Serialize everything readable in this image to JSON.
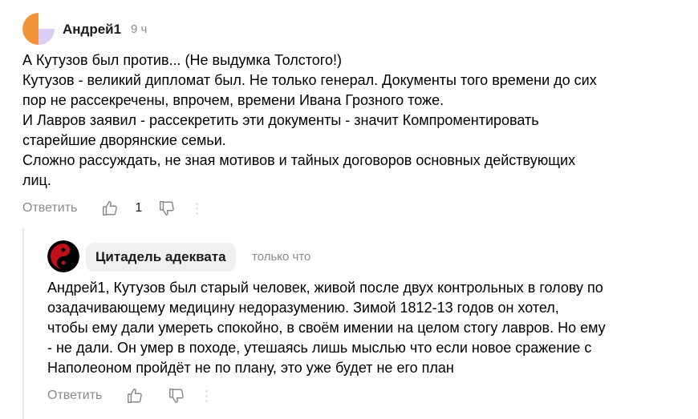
{
  "comments": [
    {
      "author": "Андрей1",
      "time": "9 ч",
      "lines": [
        "А Кутузов был против... (Не выдумка Толстого!)",
        "Кутузов - великий дипломат был. Не только генерал. Документы того времени до сих",
        "пор не рассекречены, впрочем, времени Ивана Грозного тоже.",
        "И Лавров заявил - рассекретить эти документы - значит Компроментировать",
        "старейшие дворянские семьи.",
        "Сложно рассуждать, не зная мотивов и тайных договоров основных действующих",
        "лиц."
      ],
      "reply_label": "Ответить",
      "likes": "1",
      "avatar_colors": [
        "#f2933a",
        "#ffffff",
        "#d9cff5"
      ]
    },
    {
      "author": "Цитадель адеквата",
      "time": "только что",
      "lines": [
        "Андрей1, Кутузов был старый человек, живой после двух контрольных в голову по",
        "озадачивающему медицину недоразумению. Зимой 1812-13 годов он хотел,",
        "чтобы ему дали умереть спокойно, в своём имении на целом стогу лавров. Но ему",
        "- не дали. Он умер в походе, утешаясь лишь мыслью что если новое сражение с",
        "Наполеоном пройдёт не по плану, это уже будет не его план"
      ],
      "reply_label": "Ответить",
      "avatar_colors": [
        "#000000",
        "#c0101a"
      ]
    }
  ]
}
